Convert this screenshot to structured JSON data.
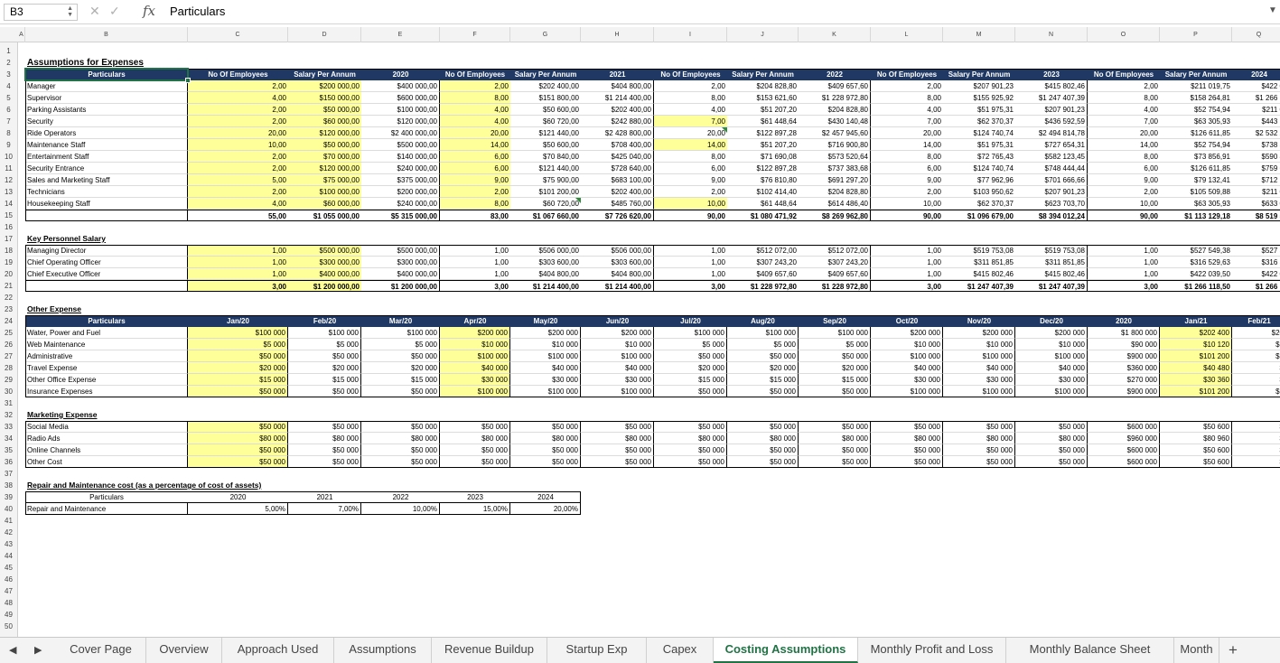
{
  "formula_bar": {
    "cell_ref": "B3",
    "content": "Particulars",
    "fx": "fx",
    "cancel": "✕",
    "confirm": "✓"
  },
  "columns": [
    "A",
    "B",
    "C",
    "D",
    "E",
    "F",
    "G",
    "H",
    "I",
    "J",
    "K",
    "L",
    "M",
    "N",
    "O",
    "P",
    "Q"
  ],
  "rows": [
    "1",
    "2",
    "3",
    "4",
    "5",
    "6",
    "7",
    "8",
    "9",
    "10",
    "11",
    "12",
    "13",
    "14",
    "15",
    "16",
    "17",
    "18",
    "19",
    "20",
    "21",
    "22",
    "23",
    "24",
    "25",
    "26",
    "27",
    "28",
    "29",
    "30",
    "31",
    "32",
    "33",
    "34",
    "35",
    "36",
    "37",
    "38",
    "39",
    "40",
    "41",
    "42",
    "43",
    "44",
    "45",
    "46",
    "47",
    "48",
    "49",
    "50"
  ],
  "title": "Assumptions for Expenses",
  "salary": {
    "header": [
      "Particulars",
      "No Of Employees",
      "Salary Per Annum",
      "2020",
      "No Of Employees",
      "Salary Per Annum",
      "2021",
      "No Of Employees",
      "Salary Per Annum",
      "2022",
      "No Of Employees",
      "Salary Per Annum",
      "2023",
      "No Of Employees",
      "Salary Per Annum",
      "2024"
    ],
    "rows": [
      [
        "Manager",
        "2,00",
        "$200 000,00",
        "$400 000,00",
        "2,00",
        "$202 400,00",
        "$404 800,00",
        "2,00",
        "$204 828,80",
        "$409 657,60",
        "2,00",
        "$207 901,23",
        "$415 802,46",
        "2,00",
        "$211 019,75",
        "$422 0"
      ],
      [
        "Supervisor",
        "4,00",
        "$150 000,00",
        "$600 000,00",
        "8,00",
        "$151 800,00",
        "$1 214 400,00",
        "8,00",
        "$153 621,60",
        "$1 228 972,80",
        "8,00",
        "$155 925,92",
        "$1 247 407,39",
        "8,00",
        "$158 264,81",
        "$1 266 1"
      ],
      [
        "Parking Assistants",
        "2,00",
        "$50 000,00",
        "$100 000,00",
        "4,00",
        "$50 600,00",
        "$202 400,00",
        "4,00",
        "$51 207,20",
        "$204 828,80",
        "4,00",
        "$51 975,31",
        "$207 901,23",
        "4,00",
        "$52 754,94",
        "$211 0"
      ],
      [
        "Security",
        "2,00",
        "$60 000,00",
        "$120 000,00",
        "4,00",
        "$60 720,00",
        "$242 880,00",
        "7,00",
        "$61 448,64",
        "$430 140,48",
        "7,00",
        "$62 370,37",
        "$436 592,59",
        "7,00",
        "$63 305,93",
        "$443 1"
      ],
      [
        "Ride Operators",
        "20,00",
        "$120 000,00",
        "$2 400 000,00",
        "20,00",
        "$121 440,00",
        "$2 428 800,00",
        "20,00",
        "$122 897,28",
        "$2 457 945,60",
        "20,00",
        "$124 740,74",
        "$2 494 814,78",
        "20,00",
        "$126 611,85",
        "$2 532 2"
      ],
      [
        "Maintenance Staff",
        "10,00",
        "$50 000,00",
        "$500 000,00",
        "14,00",
        "$50 600,00",
        "$708 400,00",
        "14,00",
        "$51 207,20",
        "$716 900,80",
        "14,00",
        "$51 975,31",
        "$727 654,31",
        "14,00",
        "$52 754,94",
        "$738 5"
      ],
      [
        "Entertainment Staff",
        "2,00",
        "$70 000,00",
        "$140 000,00",
        "6,00",
        "$70 840,00",
        "$425 040,00",
        "8,00",
        "$71 690,08",
        "$573 520,64",
        "8,00",
        "$72 765,43",
        "$582 123,45",
        "8,00",
        "$73 856,91",
        "$590 8"
      ],
      [
        "Security Entrance",
        "2,00",
        "$120 000,00",
        "$240 000,00",
        "6,00",
        "$121 440,00",
        "$728 640,00",
        "6,00",
        "$122 897,28",
        "$737 383,68",
        "6,00",
        "$124 740,74",
        "$748 444,44",
        "6,00",
        "$126 611,85",
        "$759 6"
      ],
      [
        "Sales and Marketing Staff",
        "5,00",
        "$75 000,00",
        "$375 000,00",
        "9,00",
        "$75 900,00",
        "$683 100,00",
        "9,00",
        "$76 810,80",
        "$691 297,20",
        "9,00",
        "$77 962,96",
        "$701 666,66",
        "9,00",
        "$79 132,41",
        "$712 1"
      ],
      [
        "Technicians",
        "2,00",
        "$100 000,00",
        "$200 000,00",
        "2,00",
        "$101 200,00",
        "$202 400,00",
        "2,00",
        "$102 414,40",
        "$204 828,80",
        "2,00",
        "$103 950,62",
        "$207 901,23",
        "2,00",
        "$105 509,88",
        "$211 0"
      ],
      [
        "Housekeeping Staff",
        "4,00",
        "$60 000,00",
        "$240 000,00",
        "8,00",
        "$60 720,00",
        "$485 760,00",
        "10,00",
        "$61 448,64",
        "$614 486,40",
        "10,00",
        "$62 370,37",
        "$623 703,70",
        "10,00",
        "$63 305,93",
        "$633 0"
      ]
    ],
    "total": [
      "",
      "55,00",
      "$1 055 000,00",
      "$5 315 000,00",
      "83,00",
      "$1 067 660,00",
      "$7 726 620,00",
      "90,00",
      "$1 080 471,92",
      "$8 269 962,80",
      "90,00",
      "$1 096 679,00",
      "$8 394 012,24",
      "90,00",
      "$1 113 129,18",
      "$8 519 5"
    ]
  },
  "key_personnel": {
    "title": "Key Personnel Salary",
    "rows": [
      [
        "Managing Director",
        "1,00",
        "$500 000,00",
        "$500 000,00",
        "1,00",
        "$506 000,00",
        "$506 000,00",
        "1,00",
        "$512 072,00",
        "$512 072,00",
        "1,00",
        "$519 753,08",
        "$519 753,08",
        "1,00",
        "$527 549,38",
        "$527 5"
      ],
      [
        "Chief Operating Officer",
        "1,00",
        "$300 000,00",
        "$300 000,00",
        "1,00",
        "$303 600,00",
        "$303 600,00",
        "1,00",
        "$307 243,20",
        "$307 243,20",
        "1,00",
        "$311 851,85",
        "$311 851,85",
        "1,00",
        "$316 529,63",
        "$316 5"
      ],
      [
        "Chief Executive Officer",
        "1,00",
        "$400 000,00",
        "$400 000,00",
        "1,00",
        "$404 800,00",
        "$404 800,00",
        "1,00",
        "$409 657,60",
        "$409 657,60",
        "1,00",
        "$415 802,46",
        "$415 802,46",
        "1,00",
        "$422 039,50",
        "$422 0"
      ]
    ],
    "total": [
      "",
      "3,00",
      "$1 200 000,00",
      "$1 200 000,00",
      "3,00",
      "$1 214 400,00",
      "$1 214 400,00",
      "3,00",
      "$1 228 972,80",
      "$1 228 972,80",
      "3,00",
      "$1 247 407,39",
      "$1 247 407,39",
      "3,00",
      "$1 266 118,50",
      "$1 266 1"
    ]
  },
  "other_expense": {
    "title": "Other Expense",
    "header": [
      "Particulars",
      "Jan/20",
      "Feb/20",
      "Mar/20",
      "Apr/20",
      "May/20",
      "Jun/20",
      "Jul/20",
      "Aug/20",
      "Sep/20",
      "Oct/20",
      "Nov/20",
      "Dec/20",
      "2020",
      "Jan/21",
      "Feb/21"
    ],
    "rows": [
      [
        "Water, Power and Fuel",
        "$100 000",
        "$100 000",
        "$100 000",
        "$200 000",
        "$200 000",
        "$200 000",
        "$100 000",
        "$100 000",
        "$100 000",
        "$200 000",
        "$200 000",
        "$200 000",
        "$1 800 000",
        "$202 400",
        "$20"
      ],
      [
        "Web Maintenance",
        "$5 000",
        "$5 000",
        "$5 000",
        "$10 000",
        "$10 000",
        "$10 000",
        "$5 000",
        "$5 000",
        "$5 000",
        "$10 000",
        "$10 000",
        "$10 000",
        "$90 000",
        "$10 120",
        "$1"
      ],
      [
        "Administrative",
        "$50 000",
        "$50 000",
        "$50 000",
        "$100 000",
        "$100 000",
        "$100 000",
        "$50 000",
        "$50 000",
        "$50 000",
        "$100 000",
        "$100 000",
        "$100 000",
        "$900 000",
        "$101 200",
        "$1"
      ],
      [
        "Travel Expense",
        "$20 000",
        "$20 000",
        "$20 000",
        "$40 000",
        "$40 000",
        "$40 000",
        "$20 000",
        "$20 000",
        "$20 000",
        "$40 000",
        "$40 000",
        "$40 000",
        "$360 000",
        "$40 480",
        "$"
      ],
      [
        "Other Office Expense",
        "$15 000",
        "$15 000",
        "$15 000",
        "$30 000",
        "$30 000",
        "$30 000",
        "$15 000",
        "$15 000",
        "$15 000",
        "$30 000",
        "$30 000",
        "$30 000",
        "$270 000",
        "$30 360",
        "$"
      ],
      [
        "Insurance Expenses",
        "$50 000",
        "$50 000",
        "$50 000",
        "$100 000",
        "$100 000",
        "$100 000",
        "$50 000",
        "$50 000",
        "$50 000",
        "$100 000",
        "$100 000",
        "$100 000",
        "$900 000",
        "$101 200",
        "$1"
      ]
    ]
  },
  "marketing": {
    "title": "Marketing Expense",
    "rows": [
      [
        "Social Media",
        "$50 000",
        "$50 000",
        "$50 000",
        "$50 000",
        "$50 000",
        "$50 000",
        "$50 000",
        "$50 000",
        "$50 000",
        "$50 000",
        "$50 000",
        "$50 000",
        "$600 000",
        "$50 600",
        "$"
      ],
      [
        "Radio Ads",
        "$80 000",
        "$80 000",
        "$80 000",
        "$80 000",
        "$80 000",
        "$80 000",
        "$80 000",
        "$80 000",
        "$80 000",
        "$80 000",
        "$80 000",
        "$80 000",
        "$960 000",
        "$80 960",
        "$"
      ],
      [
        "Online Channels",
        "$50 000",
        "$50 000",
        "$50 000",
        "$50 000",
        "$50 000",
        "$50 000",
        "$50 000",
        "$50 000",
        "$50 000",
        "$50 000",
        "$50 000",
        "$50 000",
        "$600 000",
        "$50 600",
        "$"
      ],
      [
        "Other Cost",
        "$50 000",
        "$50 000",
        "$50 000",
        "$50 000",
        "$50 000",
        "$50 000",
        "$50 000",
        "$50 000",
        "$50 000",
        "$50 000",
        "$50 000",
        "$50 000",
        "$600 000",
        "$50 600",
        "$"
      ]
    ]
  },
  "repair": {
    "title": "Repair and Maintenance cost (as a percentage of cost of assets)",
    "header": [
      "Particulars",
      "2020",
      "2021",
      "2022",
      "2023",
      "2024"
    ],
    "row": [
      "Repair and Maintenance",
      "5,00%",
      "7,00%",
      "10,00%",
      "15,00%",
      "20,00%"
    ]
  },
  "tabs": [
    "Cover Page",
    "Overview",
    "Approach Used",
    "Assumptions",
    "Revenue Buildup",
    "Startup Exp",
    "Capex",
    "Costing Assumptions",
    "Monthly Profit and Loss",
    "Monthly Balance Sheet",
    "Month"
  ],
  "active_tab": "Costing Assumptions",
  "nav": {
    "prev": "◀",
    "next": "▶",
    "add": "+"
  },
  "colors": {
    "header_fill": "#1f3864",
    "input_fill": "#ffff99",
    "accent": "#217346"
  }
}
